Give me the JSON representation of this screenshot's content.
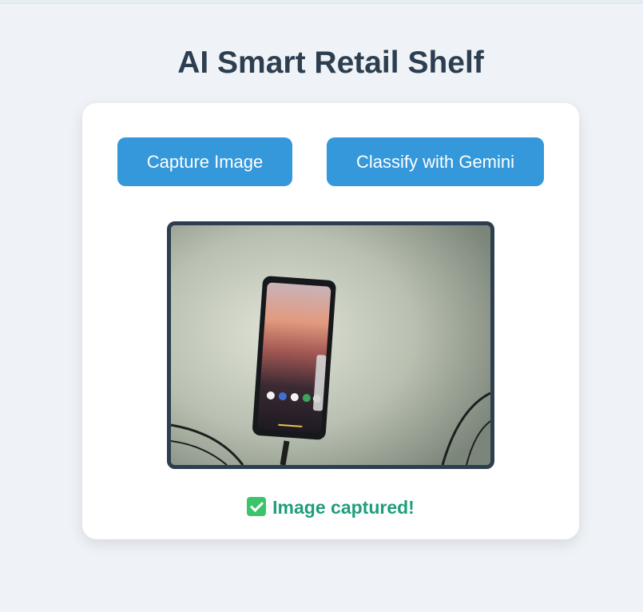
{
  "header": {
    "title": "AI Smart Retail Shelf"
  },
  "controls": {
    "capture_label": "Capture Image",
    "classify_label": "Classify with Gemini"
  },
  "preview": {
    "alt": "Captured camera image"
  },
  "status": {
    "icon": "check-box-icon",
    "text": "Image captured!"
  },
  "colors": {
    "accent": "#3498db",
    "title": "#2c3e50",
    "success": "#1f9e7d",
    "background": "#eff2f6"
  }
}
